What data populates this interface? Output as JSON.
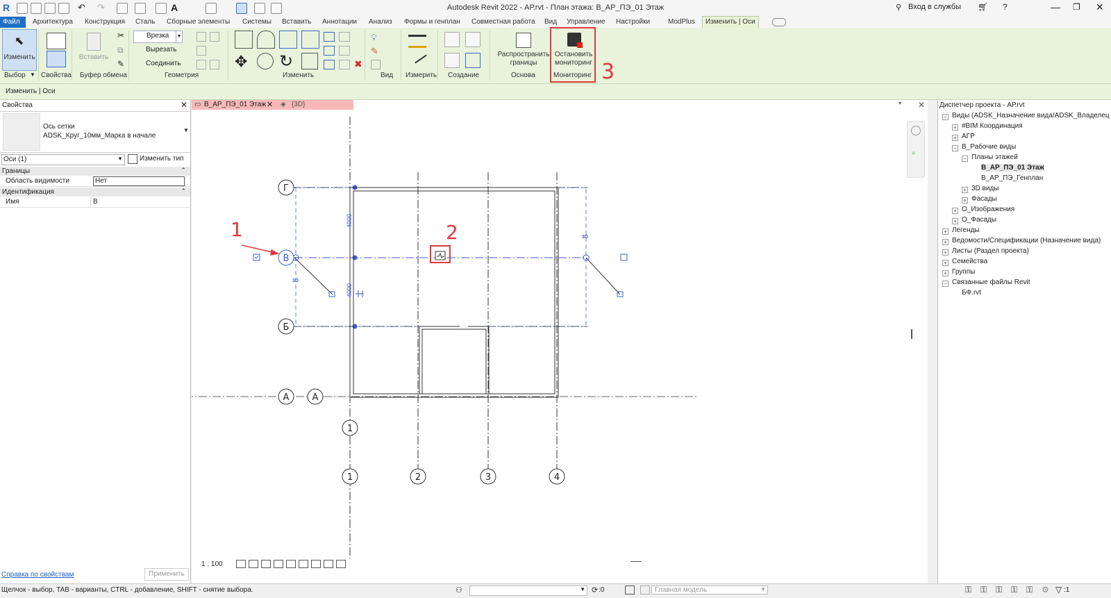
{
  "window": {
    "title": "Autodesk Revit 2022 - АР.rvt - План этажа: В_АР_ПЭ_01 Этаж",
    "sign_in": "Вход в службы"
  },
  "tabs": [
    {
      "label": "Файл"
    },
    {
      "label": "Архитектура"
    },
    {
      "label": "Конструкция"
    },
    {
      "label": "Сталь"
    },
    {
      "label": "Сборные элементы"
    },
    {
      "label": "Системы"
    },
    {
      "label": "Вставить"
    },
    {
      "label": "Аннотации"
    },
    {
      "label": "Анализ"
    },
    {
      "label": "Формы и генплан"
    },
    {
      "label": "Совместная работа"
    },
    {
      "label": "Вид"
    },
    {
      "label": "Управление"
    },
    {
      "label": "Настройки"
    },
    {
      "label": "ModPlus"
    },
    {
      "label": "Изменить | Оси"
    }
  ],
  "ribbon": {
    "modify_label": "Изменить",
    "paste_label": "Вставить",
    "cope_label": "Врезка",
    "cut_label": "Вырезать",
    "join_label": "Соединить",
    "propagate_label": "Распространить границы",
    "stop_monitor_label": "Остановить мониторинг",
    "panels": {
      "select": "Выбор",
      "properties": "Свойства",
      "clipboard": "Буфер обмена",
      "geometry": "Геометрия",
      "modify": "Изменить",
      "view": "Вид",
      "measure": "Измерить",
      "create": "Создание",
      "datum": "Основа",
      "monitor": "Мониторинг"
    }
  },
  "option_bar": {
    "context": "Изменить | Оси"
  },
  "properties": {
    "title": "Свойства",
    "type_family": "Ось сетки",
    "type_name": "ADSK_Круг_10мм_Марка в начале",
    "selector_value": "Оси (1)",
    "edit_type": "Изменить тип",
    "groups": [
      {
        "name": "Границы",
        "rows": [
          {
            "label": "Область видимости",
            "value": "Нет"
          }
        ]
      },
      {
        "name": "Идентификация",
        "rows": [
          {
            "label": "Имя",
            "value": "В"
          }
        ]
      }
    ],
    "help_link": "Справка по свойствам",
    "apply": "Применить"
  },
  "view_tabs": [
    {
      "label": "В_АР_ПЭ_01 Этаж",
      "active": true
    },
    {
      "label": "{3D}",
      "active": false
    }
  ],
  "view": {
    "scale": "1 : 100",
    "grid_labels": {
      "rows": [
        "Г",
        "В",
        "Б",
        "А",
        "А"
      ],
      "cols_top": [
        "1"
      ],
      "cols_bottom": [
        "1",
        "2",
        "3",
        "4"
      ]
    },
    "dims": [
      "4000",
      "4000"
    ],
    "grid_3d_marks": [
      "3D",
      "3D"
    ]
  },
  "annotations": [
    "1",
    "2",
    "3"
  ],
  "project_browser": {
    "title": "Диспетчер проекта - АР.rvt",
    "items": [
      {
        "label": "Виды (ADSK_Назначение вида/ADSK_Владелец",
        "level": 0,
        "toggle": "-"
      },
      {
        "label": "#BIM Координация",
        "level": 1,
        "toggle": "+"
      },
      {
        "label": "АГР",
        "level": 1,
        "toggle": "+"
      },
      {
        "label": "В_Рабочие виды",
        "level": 1,
        "toggle": "-"
      },
      {
        "label": "Планы этажей",
        "level": 2,
        "toggle": "-"
      },
      {
        "label": "В_АР_ПЭ_01 Этаж",
        "level": 3,
        "toggle": ""
      },
      {
        "label": "В_АР_ПЭ_Генплан",
        "level": 3,
        "toggle": ""
      },
      {
        "label": "3D виды",
        "level": 2,
        "toggle": "+"
      },
      {
        "label": "Фасады",
        "level": 2,
        "toggle": "+"
      },
      {
        "label": "О_Изображения",
        "level": 1,
        "toggle": "+"
      },
      {
        "label": "О_Фасады",
        "level": 1,
        "toggle": "+"
      },
      {
        "label": "Легенды",
        "level": 0,
        "toggle": "+"
      },
      {
        "label": "Ведомости/Спецификации (Назначение вида)",
        "level": 0,
        "toggle": "+"
      },
      {
        "label": "Листы (Раздел проекта)",
        "level": 0,
        "toggle": "+"
      },
      {
        "label": "Семейства",
        "level": 0,
        "toggle": "+"
      },
      {
        "label": "Группы",
        "level": 0,
        "toggle": "+"
      },
      {
        "label": "Связанные файлы Revit",
        "level": 0,
        "toggle": "-"
      },
      {
        "label": "БФ.rvt",
        "level": 1,
        "toggle": ""
      }
    ]
  },
  "status": {
    "hint": "Щелчок - выбор, TAB - варианты, CTRL - добавление, SHIFT - снятие выбора.",
    "workset_value": "",
    "zero": ":0",
    "model": "Главная модель",
    "filter_count": ":1"
  },
  "colors": {
    "ribbon_bg": "#e9f3dc",
    "file_tab": "#1f6fc5",
    "selected_blue": "#3d5bd6",
    "annotation_red": "#e0383b"
  }
}
